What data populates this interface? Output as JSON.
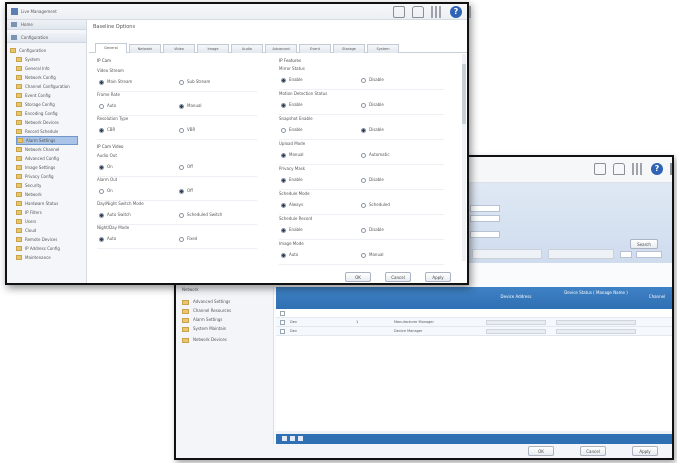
{
  "back_window": {
    "header_icons": [
      "box-icon",
      "lock-icon",
      "grid-icon",
      "help-icon",
      "exit-icon"
    ],
    "search_button": "Search",
    "sidebar_items": [
      "Network",
      "Advanced Settings",
      "Channel Resources",
      "Alarm Settings",
      "System Maintain",
      "Network Devices"
    ],
    "table_headers": [
      "Device Address",
      "Device Status ( Manage Name )",
      "Channel"
    ],
    "rows": [
      {
        "name": "Dev",
        "num": "1",
        "desc": "Manufacturer Manager",
        "status": "---"
      },
      {
        "name": "Dev",
        "num": "",
        "desc": "Device Manager",
        "status": "---"
      }
    ],
    "footer_buttons": [
      "OK",
      "Cancel",
      "Apply"
    ]
  },
  "front_window": {
    "title": "Live Management",
    "header_icons": [
      "box-icon",
      "lock-icon",
      "grid-icon",
      "help-icon",
      "exit-icon"
    ],
    "sidebar": {
      "sections": [
        "Home",
        "Configuration"
      ],
      "items": [
        "Configuration",
        "System",
        "General Info",
        "Network Config",
        "Channel Configuration",
        "Event Config",
        "Storage Config",
        "Encoding Config",
        "Network Devices",
        "Record Schedule",
        "Alarm Settings",
        "Network Channel",
        "Advanced Config",
        "Image Settings",
        "Privacy Config",
        "Security",
        "Network",
        "Hardware Status",
        "IP Filters",
        "Users",
        "Cloud",
        "Remote Devices",
        "IP Address Config",
        "Maintenance"
      ],
      "selected_index": 10
    },
    "dialog_title": "Baseline Options",
    "tabs": [
      "General",
      "Network",
      "Video",
      "Image",
      "Audio",
      "Advanced",
      "Event",
      "Storage",
      "System"
    ],
    "active_tab": 0,
    "left_section": "IP Cam",
    "left_groups": [
      {
        "label": "Video Stream",
        "options": [
          "Main Stream",
          "Sub Stream"
        ],
        "selected": 0
      },
      {
        "label": "Frame Rate",
        "options": [
          "Auto",
          "Manual"
        ],
        "selected": 1
      },
      {
        "label": "Resolution Type",
        "options": [
          "CBR",
          "VBR"
        ],
        "selected": 0
      }
    ],
    "left_section2": "IP Cam Video",
    "left_groups2": [
      {
        "label": "Audio Out",
        "options": [
          "On",
          "Off"
        ],
        "selected": 0
      },
      {
        "label": "Alarm Out",
        "options": [
          "On",
          "Off"
        ],
        "selected": 1
      },
      {
        "label": "Day/Night Switch Mode",
        "options": [
          "Auto Switch",
          "Scheduled Switch"
        ],
        "selected": 0
      },
      {
        "label": "Night/Day Mode",
        "options": [
          "Auto",
          "Fixed"
        ],
        "selected": 0
      }
    ],
    "right_section": "IP Features",
    "right_groups": [
      {
        "label": "Mirror Status",
        "options": [
          "Enable",
          "Disable"
        ],
        "selected": 0
      },
      {
        "label": "Motion Detection Status",
        "options": [
          "Enable",
          "Disable"
        ],
        "selected": 0
      },
      {
        "label": "Snapshot Enable",
        "options": [
          "Enable",
          "Disable"
        ],
        "selected": 1
      },
      {
        "label": "Upload Mode",
        "options": [
          "Manual",
          "Automatic"
        ],
        "selected": 0
      },
      {
        "label": "Privacy Mask",
        "options": [
          "Enable",
          "Disable"
        ],
        "selected": 0
      },
      {
        "label": "Schedule Mode",
        "options": [
          "Always",
          "Scheduled"
        ],
        "selected": 0
      },
      {
        "label": "Schedule Record",
        "options": [
          "Enable",
          "Disable"
        ],
        "selected": 0
      },
      {
        "label": "Image Mode",
        "options": [
          "Auto",
          "Manual"
        ],
        "selected": 0
      }
    ],
    "footer_buttons": [
      "OK",
      "Cancel",
      "Apply"
    ]
  },
  "colors": {
    "accent_blue": "#2f6fb3",
    "selection": "#a9c4e6"
  }
}
